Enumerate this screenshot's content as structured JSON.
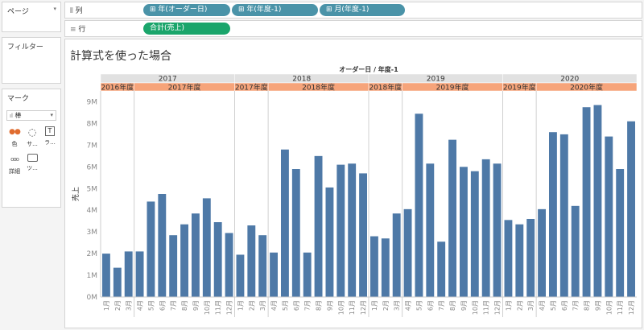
{
  "left_panels": {
    "pages": {
      "title": "ページ"
    },
    "filters": {
      "title": "フィルター"
    },
    "marks": {
      "title": "マーク",
      "type_select": "棒",
      "buttons": [
        {
          "label": "色",
          "icon": "color-icon"
        },
        {
          "label": "サ...",
          "icon": "size-icon"
        },
        {
          "label": "ラ...",
          "icon": "label-icon"
        },
        {
          "label": "詳細",
          "icon": "detail-icon"
        },
        {
          "label": "ツ...",
          "icon": "tooltip-icon"
        }
      ]
    }
  },
  "shelves": {
    "columns": {
      "label": "列",
      "pills": [
        "年(オーダー日)",
        "年(年度-1)",
        "月(年度-1)"
      ]
    },
    "rows": {
      "label": "行",
      "pills": [
        "合計(売上)"
      ]
    }
  },
  "worksheet": {
    "title": "計算式を使った場合"
  },
  "chart_data": {
    "type": "bar",
    "color": "#4e79a7",
    "header_title": "オーダー日 / 年度-1",
    "ylabel": "売上",
    "ylim": [
      0,
      9500000
    ],
    "yticks": [
      "0M",
      "1M",
      "2M",
      "3M",
      "4M",
      "5M",
      "6M",
      "7M",
      "8M",
      "9M"
    ],
    "grid": false,
    "year_groups": [
      {
        "year": "2017",
        "fy": [
          {
            "label": "2016年度",
            "months": 3
          },
          {
            "label": "2017年度",
            "months": 9
          }
        ]
      },
      {
        "year": "2018",
        "fy": [
          {
            "label": "2017年度",
            "months": 3
          },
          {
            "label": "2018年度",
            "months": 9
          }
        ]
      },
      {
        "year": "2019",
        "fy": [
          {
            "label": "2018年度",
            "months": 3
          },
          {
            "label": "2019年度",
            "months": 9
          }
        ]
      },
      {
        "year": "2020",
        "fy": [
          {
            "label": "2019年度",
            "months": 3
          },
          {
            "label": "2020年度",
            "months": 9
          }
        ]
      }
    ],
    "categories": [
      "1月",
      "2月",
      "3月",
      "4月",
      "5月",
      "6月",
      "7月",
      "8月",
      "9月",
      "10月",
      "11月",
      "12月",
      "1月",
      "2月",
      "3月",
      "4月",
      "5月",
      "6月",
      "7月",
      "8月",
      "9月",
      "10月",
      "11月",
      "12月",
      "1月",
      "2月",
      "3月",
      "4月",
      "5月",
      "6月",
      "7月",
      "8月",
      "9月",
      "10月",
      "11月",
      "12月",
      "1月",
      "2月",
      "3月",
      "4月",
      "5月",
      "6月",
      "7月",
      "8月",
      "9月",
      "10月",
      "11月",
      "12月"
    ],
    "values": [
      2000000,
      1350000,
      2100000,
      2100000,
      4400000,
      4750000,
      2850000,
      3350000,
      3850000,
      4550000,
      3450000,
      2950000,
      1950000,
      3300000,
      2850000,
      2050000,
      6800000,
      5900000,
      2050000,
      6500000,
      5050000,
      6100000,
      6150000,
      5700000,
      2800000,
      2700000,
      3850000,
      4050000,
      8450000,
      6150000,
      2550000,
      7250000,
      6000000,
      5800000,
      6350000,
      6150000,
      3550000,
      3350000,
      3600000,
      4050000,
      7600000,
      7500000,
      4200000,
      8750000,
      8850000,
      7400000,
      5900000,
      8100000
    ]
  }
}
